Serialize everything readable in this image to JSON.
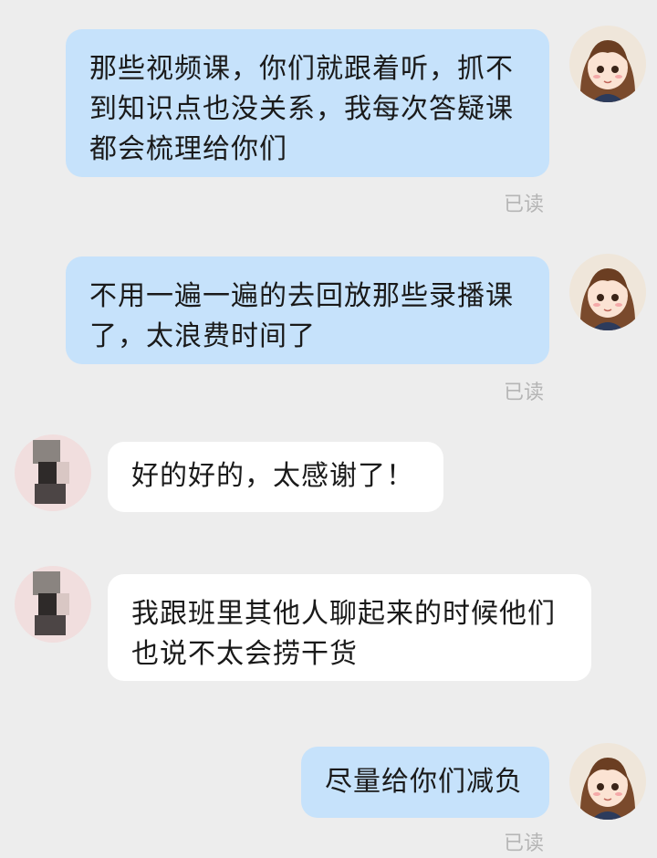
{
  "messages": [
    {
      "text": "那些视频课，你们就跟着听，抓不\n到知识点也没关系，我每次答疑课\n都会梳理给你们",
      "sender": "self",
      "status": "已读"
    },
    {
      "text": "不用一遍一遍的去回放那些录播课\n了，太浪费时间了",
      "sender": "self",
      "status": "已读"
    },
    {
      "text": "好的好的，太感谢了！",
      "sender": "other"
    },
    {
      "text": "我跟班里其他人聊起来的时候他们\n也说不太会捞干货",
      "sender": "other"
    },
    {
      "text": "尽量给你们减负",
      "sender": "self",
      "status": "已读"
    }
  ],
  "colors": {
    "background": "#ededed",
    "self_bubble": "#c6e2fb",
    "other_bubble": "#ffffff",
    "read_receipt": "#b5b5b5"
  }
}
